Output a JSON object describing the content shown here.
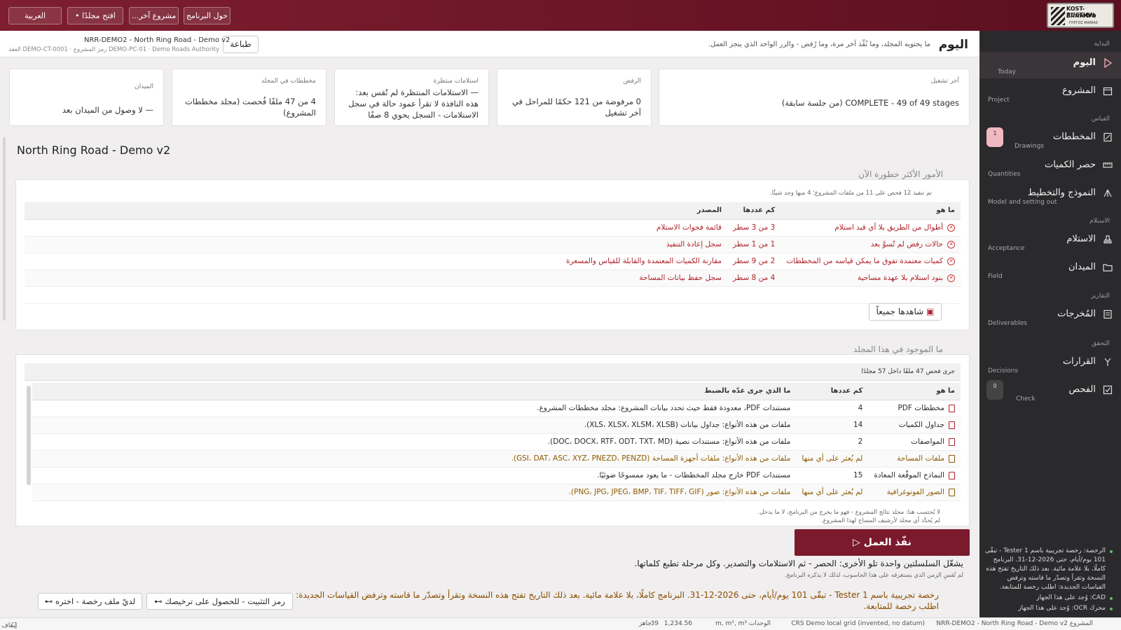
{
  "topbar": {
    "about_label": "حول البرنامج",
    "other_project_label": "مشروع آخر...",
    "open_folder_label": "افتح مجلدًا •",
    "language_label": "العربية",
    "logo": {
      "line1": "KOST-RUCTION",
      "line2": "Elimotra",
      "line3": "ΠΥΡΓΟΣ ΜΑΘΙΑΣ"
    }
  },
  "header": {
    "title": "اليوم",
    "description": "ما يحتويه المجلد، وما نُفِّذ آخر مرة، وما رُفض - والزر الواحد الذي ينجز العمل.",
    "print_label": "طباعة",
    "project_name": "NRR-DEMO2 - North Ring Road - Demo v2",
    "project_meta": "DEMO-PC-01 · Demo Roads Authority رمز المشروع · DEMO-CT-0001 العقد"
  },
  "cards": [
    {
      "label": "آخر تشغيل",
      "value": "COMPLETE - 49 of 49 stages (من جلسة سابقة)"
    },
    {
      "label": "الرفض",
      "value": "0 مرفوضة من 121 حكمًا للمراحل في آخر تشغيل"
    },
    {
      "label": "استلامات منتظرة",
      "value": "— الاستلامات المنتظرة لم تُقس بعد: هذه النافذة لا تقرأ عمود حالة في سجل الاستلامات - السجل يحوي 8 صفًا"
    },
    {
      "label": "مخططات في المجلد",
      "value": "4 من 47 ملفًا فُحصت (مجلد مخططات المشروع)"
    },
    {
      "label": "الميدان",
      "value": "— لا وصول من الميدان بعد"
    }
  ],
  "page_title": "North Ring Road - Demo v2",
  "risks": {
    "section_title": "الأمور الأكثر خطورة الآن",
    "note": "تم تنفيذ 12 فحص على 11 من ملفات المشروع؛ 4 منها وجد شيئًا.",
    "columns": [
      "ما هو",
      "كم عددها",
      "المصدر"
    ],
    "rows": [
      {
        "what": "أطوال من الطريق بلا أي قيد استلام",
        "count": "3 من 3 سطر",
        "source": "قائمة فجوات الاستلام"
      },
      {
        "what": "حالات رفض لم تُسوَّ بعد",
        "count": "1 من 1 سطر",
        "source": "سجل إعادة التنفيذ"
      },
      {
        "what": "كميات معتمدة تفوق ما يمكن قياسه من المخططات",
        "count": "2 من 9 سطر",
        "source": "مقارنة الكميات المعتمدة والقابلة للقياس والمسعرة"
      },
      {
        "what": "بنود استلام بلا عهدة مساحية",
        "count": "4 من 8 سطر",
        "source": "سجل حفظ بيانات المساحة"
      }
    ],
    "view_all_label": "شاهدها جميعاً"
  },
  "folder": {
    "section_title": "ما الموجود في هذا المجلد",
    "note": "جرى فحص 47 ملفًا داخل 57 مجلدًا",
    "columns": [
      "ما هو",
      "كم عددها",
      "ما الذي جرى عدّه بالضبط"
    ],
    "rows": [
      {
        "what": "مخططات PDF",
        "count": "4",
        "detail": "مستندات PDF، معدودة فقط حيث تحدد بيانات المشروع: مجلد مخططات المشروع.",
        "tone": "normal"
      },
      {
        "what": "جداول الكميات",
        "count": "14",
        "detail": "ملفات من هذه الأنواع: جداول بيانات (XLS، XLSX، XLSM، XLSB).",
        "tone": "normal"
      },
      {
        "what": "المواصفات",
        "count": "2",
        "detail": "ملفات من هذه الأنواع: مستندات نصية (DOC، DOCX، RTF، ODT، TXT، MD).",
        "tone": "normal"
      },
      {
        "what": "ملفات المساحة",
        "count": "لم يُعثر على أي منها",
        "detail": "ملفات من هذه الأنواع: ملفات أجهزة المساحة (GSI، DAT، ASC، XYZ، PNEZD، PENZD).",
        "tone": "amber"
      },
      {
        "what": "النماذج الموقّعة المعادة",
        "count": "15",
        "detail": "مستندات PDF خارج مجلد المخططات - ما يعود ممسوحًا ضوئيًا.",
        "tone": "normal"
      },
      {
        "what": "الصور الفوتوغرافية",
        "count": "لم يُعثر على أي منها",
        "detail": "ملفات من هذه الأنواع: صور (PNG، JPG، JPEG، BMP، TIF، TIFF، GIF).",
        "tone": "amber"
      }
    ],
    "footnote1": "لا يُحتسب هنا: مجلد نتائج المشروع - فهو ما يخرج من البرنامج، لا ما يدخل.",
    "footnote2": "لم يُحدَّد أي مجلد لأرشيف المساح لهذا المشروع."
  },
  "run": {
    "label": "نفّذ العمل ▷",
    "info": "يشغّل السلسلتين واحدة تلو الأخرى: الحصر - ثم الاستلامات والتصدير. وكل مرحلة تطبع كلماتها.",
    "note": "لم تُقسِ الزمن الذي يستغرقه على هذا الحاسوب، لذلك لا يذكره البرنامج."
  },
  "license": {
    "text": "رخصة تجريبية باسم Tester 1 - تبقّى 101 يوم/أيام، حتى 2026-12-31. البرنامج كاملًا، بلا علامة مائية. بعد ذلك التاريخ تفتح هذه النسخة وتقرأ وتصدّر ما قاسته وترفض القياسات الجديدة: اطلب رخصة للمتابعة.",
    "pin_label": "رمز التثبيت - للحصول على ترخيصك ⊶",
    "have_file_label": "لديّ ملف رخصة - اختره ⊶"
  },
  "sidebar": {
    "groups": {
      "start": "البداية",
      "measure": "القياس",
      "acceptance": "الاستلام",
      "reports": "التقارير",
      "verify": "التحقق"
    },
    "items": [
      {
        "label": "اليوم",
        "sub": "Today",
        "active": true
      },
      {
        "label": "المشروع",
        "sub": "Project"
      },
      {
        "label": "المخططات",
        "sub": "Drawings",
        "badge": "1"
      },
      {
        "label": "حصر الكميات",
        "sub": "Quantities"
      },
      {
        "label": "النموذج والتخطيط",
        "sub": "Model and setting out"
      },
      {
        "label": "الاستلام",
        "sub": "Acceptance"
      },
      {
        "label": "الميدان",
        "sub": "Field"
      },
      {
        "label": "المُخرجات",
        "sub": "Deliverables"
      },
      {
        "label": "القرارات",
        "sub": "Decisions"
      },
      {
        "label": "الفحص",
        "sub": "Check",
        "badge": "0"
      }
    ],
    "status_license": "الرخصة: رخصة تجريبية باسم Tester 1 - تبقّى 101 يوم/أيام، حتى 2026-12-31. البرنامج كاملًا، بلا علامة مائية. بعد ذلك التاريخ تفتح هذه النسخة وتقرأ وتصدّر ما قاسته وترفض القياسات الجديدة: اطلب رخصة للمتابعة.",
    "status_cad": "CAD: وُجد على هذا الجهاز",
    "status_ocr": "محرك OCR: وُجد على هذا الجهاز"
  },
  "statusbar": {
    "project": "المشروع NRR-DEMO2 - North Ring Road - Demo v2",
    "crs": "CRS Demo local grid (invented, no datum)",
    "units": "الوحدات m, m², m³",
    "coords": "1,234.56",
    "zoom": "39",
    "ready": "جاهز",
    "stop_label": "إيقاف"
  },
  "colors": {
    "brand": "#7a1a2c",
    "sidebar": "#2a2a2d",
    "danger": "#b0212a",
    "amber": "#8d5a00"
  }
}
